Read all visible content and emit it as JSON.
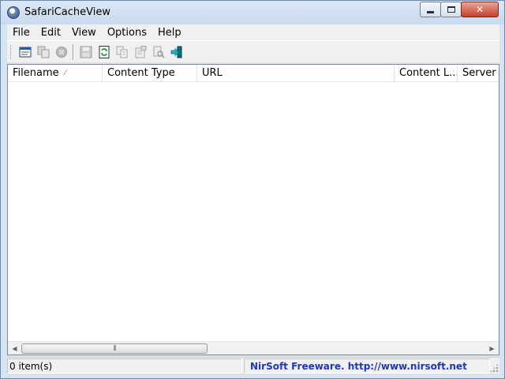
{
  "window": {
    "title": "SafariCacheView",
    "icon": "app-globe-icon",
    "controls": {
      "minimize": "minimize-icon",
      "maximize": "maximize-icon",
      "close": "✕"
    }
  },
  "menu": [
    {
      "label": "File"
    },
    {
      "label": "Edit"
    },
    {
      "label": "View"
    },
    {
      "label": "Options"
    },
    {
      "label": "Help"
    }
  ],
  "toolbar": {
    "buttons": [
      {
        "icon": "properties-window-icon",
        "enabled": true
      },
      {
        "icon": "copy-files-icon",
        "enabled": false
      },
      {
        "icon": "stop-icon",
        "enabled": false
      },
      {
        "icon": "save-icon",
        "enabled": false
      },
      {
        "icon": "refresh-icon",
        "enabled": true
      },
      {
        "icon": "copy-icon",
        "enabled": false
      },
      {
        "icon": "properties-icon",
        "enabled": false
      },
      {
        "icon": "find-icon",
        "enabled": false
      },
      {
        "icon": "exit-icon",
        "enabled": true
      }
    ]
  },
  "list": {
    "columns": [
      {
        "label": "Filename",
        "sorted": true
      },
      {
        "label": "Content Type"
      },
      {
        "label": "URL"
      },
      {
        "label": "Content L..."
      },
      {
        "label": "Server N"
      }
    ],
    "rows": [],
    "scroll_grip": "⦀"
  },
  "status": {
    "items": "0 item(s)",
    "link": "NirSoft Freeware.  http://www.nirsoft.net"
  },
  "colors": {
    "frame": "#d6e3f2",
    "link": "#1f35c8",
    "close_button": "#c7402b"
  }
}
